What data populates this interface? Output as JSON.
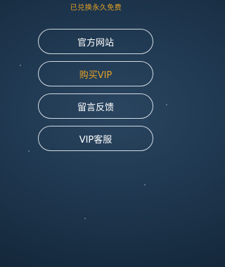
{
  "status": {
    "text": "已兑换永久免费"
  },
  "menu": {
    "items": [
      {
        "label": "官方网站",
        "highlighted": false
      },
      {
        "label": "购买VIP",
        "highlighted": true
      },
      {
        "label": "留言反馈",
        "highlighted": false
      },
      {
        "label": "VIP客服",
        "highlighted": false
      }
    ]
  },
  "colors": {
    "accent": "#e3a126",
    "button_border": "#ebf0f5",
    "background_dark": "#11202f",
    "background_light": "#2a4560"
  }
}
